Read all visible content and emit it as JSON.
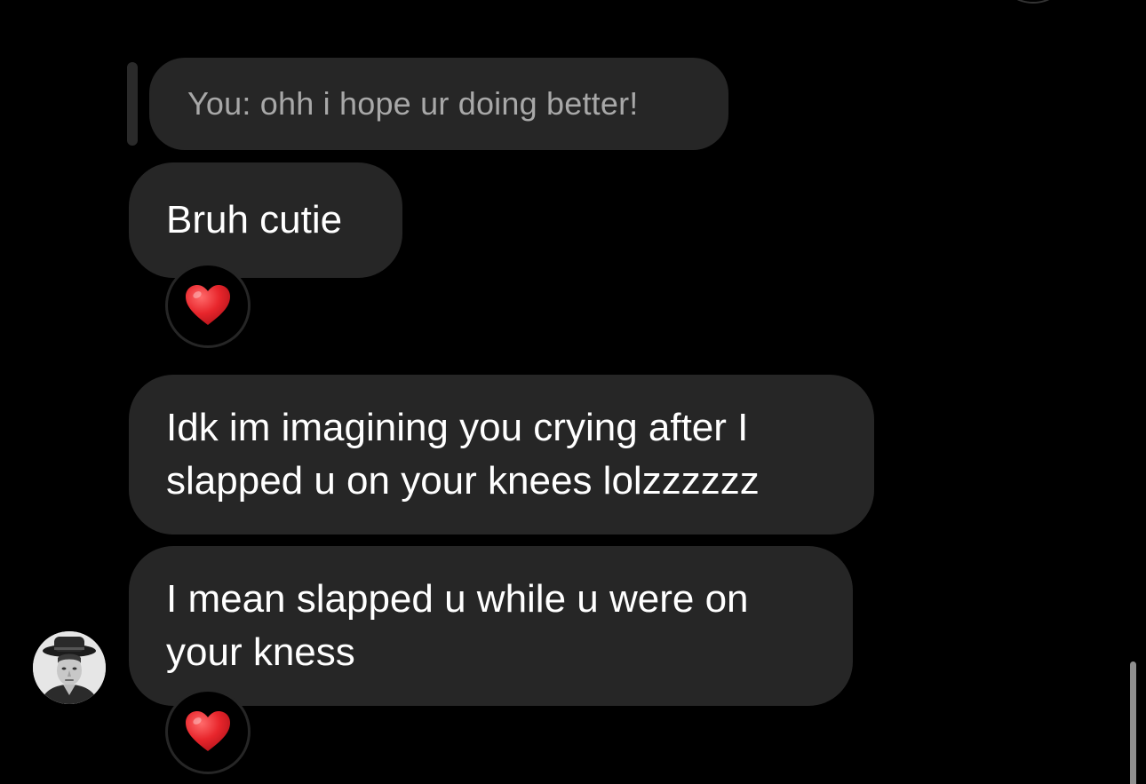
{
  "thread": {
    "reply_preview": {
      "text": "You: ohh i hope ur doing better!"
    },
    "messages": [
      {
        "text": "Bruh cutie",
        "reaction": "heart-emoji"
      },
      {
        "text": "Idk im imagining you crying after I slapped u on your knees lolzzzzzz",
        "reaction": null
      },
      {
        "text": "I mean slapped u while u were on your kness",
        "reaction": "heart-emoji"
      }
    ]
  },
  "colors": {
    "background": "#000000",
    "bubble": "#262626",
    "reply_text": "#a8a8a8",
    "message_text": "#ffffff",
    "heart": "#e8262c"
  },
  "icons": [
    "heart-emoji",
    "contact-avatar",
    "scrollbar-thumb"
  ]
}
